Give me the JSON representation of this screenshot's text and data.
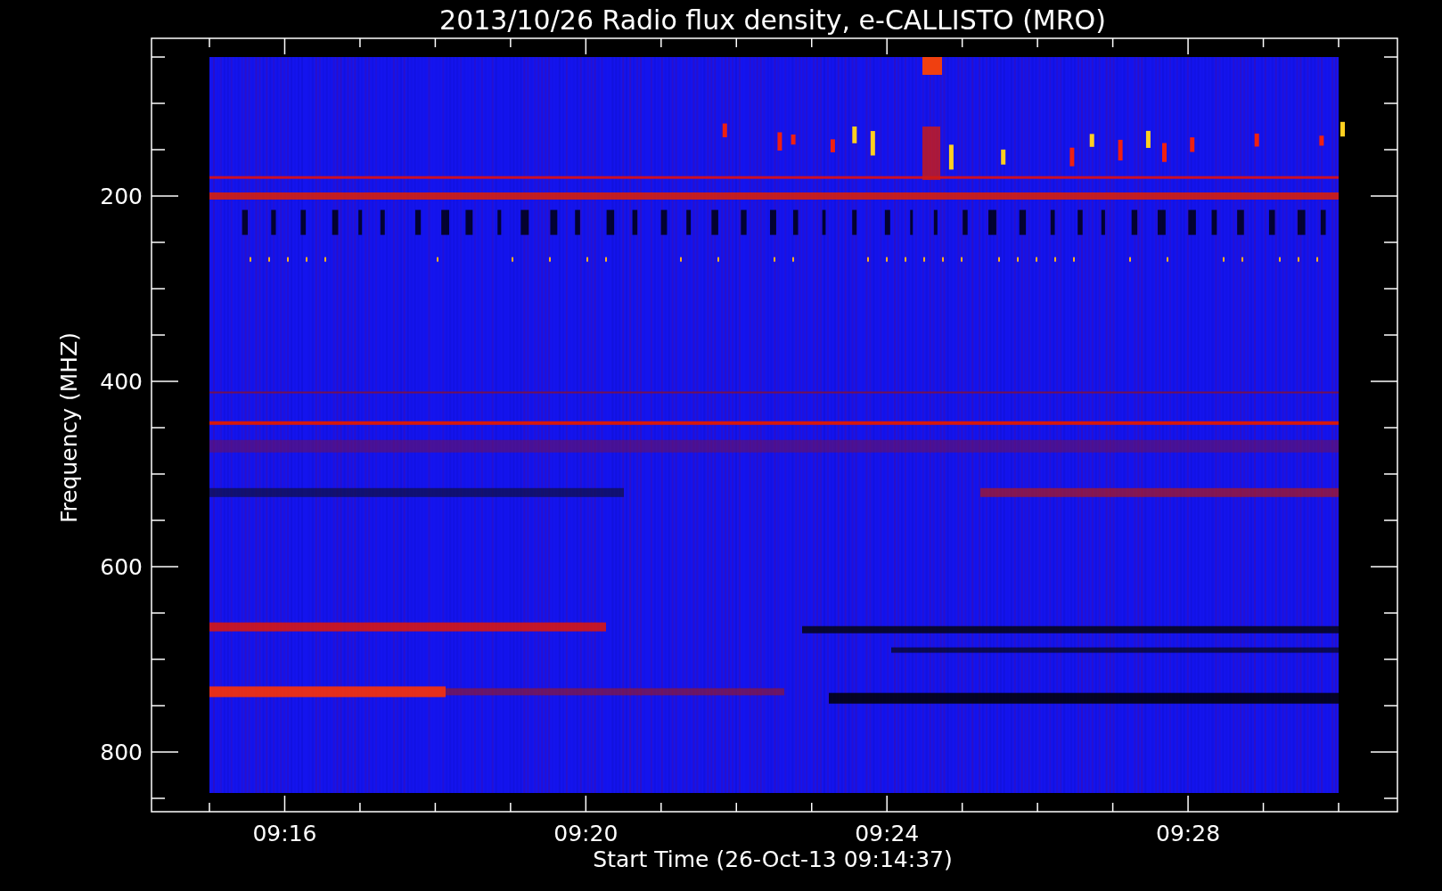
{
  "title": "2013/10/26  Radio flux density, e-CALLISTO (MRO)",
  "y_axis": {
    "label": "Frequency (MHZ)",
    "ticks": [
      "200",
      "400",
      "600",
      "800"
    ]
  },
  "x_axis": {
    "label": "Start Time (26-Oct-13 09:14:37)",
    "ticks": [
      "09:16",
      "09:20",
      "09:24",
      "09:28"
    ]
  }
}
